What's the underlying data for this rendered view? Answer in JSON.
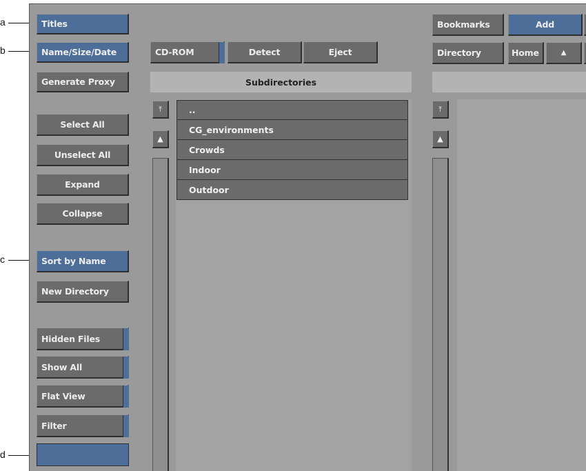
{
  "callouts": {
    "a": "a",
    "b": "b",
    "c": "c",
    "d": "d"
  },
  "left_panel": {
    "titles": "Titles",
    "name_size_date": "Name/Size/Date",
    "generate_proxy": "Generate Proxy",
    "select_all": "Select All",
    "unselect_all": "Unselect All",
    "expand": "Expand",
    "collapse": "Collapse",
    "sort_by_name": "Sort by Name",
    "new_directory": "New Directory",
    "hidden_files": "Hidden Files",
    "show_all": "Show All",
    "flat_view": "Flat View",
    "filter": "Filter",
    "filter_value": ""
  },
  "device_bar": {
    "cdrom": "CD-ROM",
    "detect": "Detect",
    "eject": "Eject"
  },
  "subdirectories": {
    "header": "Subdirectories",
    "items": [
      "..",
      "CG_environments",
      "Crowds",
      "Indoor",
      "Outdoor"
    ]
  },
  "right_panel": {
    "bookmarks": "Bookmarks",
    "add": "Add",
    "directory": "Directory",
    "home": "Home"
  },
  "icons": {
    "scroll_top": "⤒",
    "scroll_up": "▲"
  },
  "colors": {
    "panel_bg": "#9a9a9a",
    "button_gray": "#6b6b6b",
    "button_blue": "#4c6e98"
  }
}
